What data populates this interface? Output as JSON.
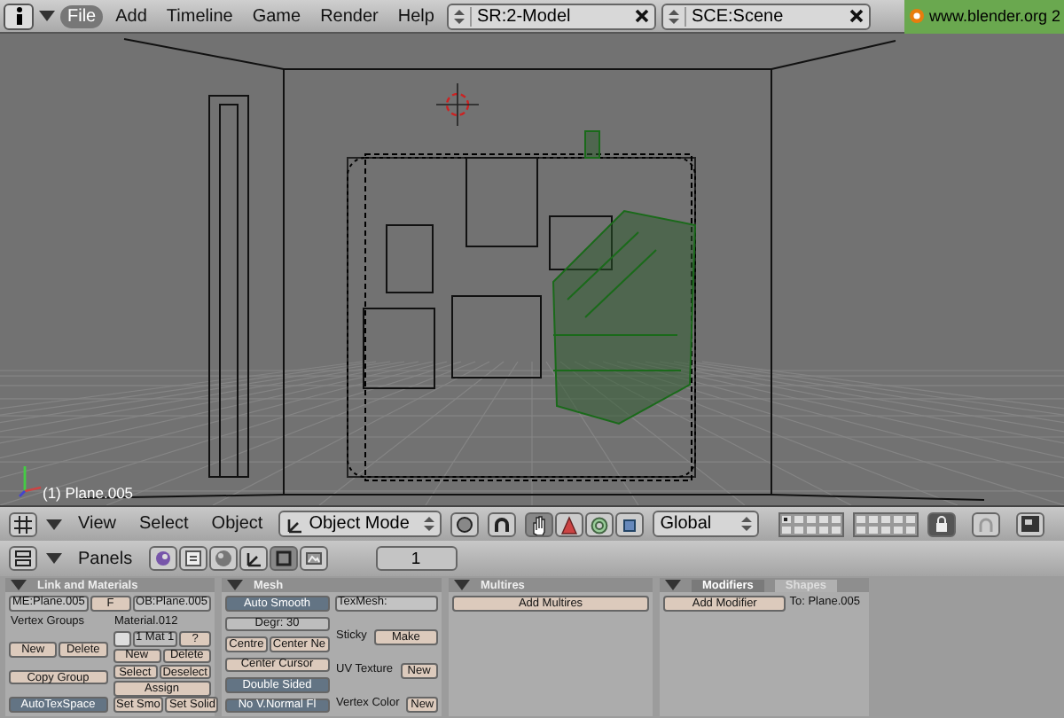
{
  "menu_bar": {
    "menus": [
      {
        "label": "File",
        "selected": true
      },
      {
        "label": "Add",
        "selected": false
      },
      {
        "label": "Timeline",
        "selected": false
      },
      {
        "label": "Game",
        "selected": false
      },
      {
        "label": "Render",
        "selected": false
      },
      {
        "label": "Help",
        "selected": false
      }
    ],
    "screen_field": "SR:2-Model",
    "scene_field": "SCE:Scene",
    "info": "www.blender.org 2"
  },
  "viewport": {
    "object_label": "(1) Plane.005"
  },
  "view_header": {
    "menus": [
      "View",
      "Select",
      "Object"
    ],
    "mode": "Object Mode",
    "manipulator_tools": [
      {
        "kind": "hand",
        "selected": true
      },
      {
        "kind": "translate",
        "selected": false
      },
      {
        "kind": "rotate",
        "selected": false
      },
      {
        "kind": "scale",
        "selected": false
      }
    ],
    "orientation": "Global",
    "layers": [
      {
        "active": true
      },
      {
        "active": false
      },
      {
        "active": false
      },
      {
        "active": false
      },
      {
        "active": false
      },
      {
        "active": false
      },
      {
        "active": false
      },
      {
        "active": false
      },
      {
        "active": false
      },
      {
        "active": false
      },
      {
        "active": false
      },
      {
        "active": false
      },
      {
        "active": false
      },
      {
        "active": false
      },
      {
        "active": false
      },
      {
        "active": false
      },
      {
        "active": false
      },
      {
        "active": false
      },
      {
        "active": false
      },
      {
        "active": false
      }
    ],
    "lock": {
      "selected": true
    }
  },
  "buttons_header": {
    "menu": "Panels",
    "contexts": [
      {
        "kind": "logic",
        "selected": false
      },
      {
        "kind": "script",
        "selected": false
      },
      {
        "kind": "shading",
        "selected": false
      },
      {
        "kind": "object",
        "selected": false
      },
      {
        "kind": "editing",
        "selected": true
      },
      {
        "kind": "scene",
        "selected": false
      }
    ],
    "frame": "1"
  },
  "panels": [
    {
      "title": "Link and Materials",
      "top": [
        [
          {
            "kind": "field",
            "text": "ME:Plane.005"
          },
          {
            "kind": "button",
            "text": "F"
          },
          {
            "kind": "field",
            "text": "OB:Plane.005"
          }
        ]
      ],
      "columns": [
        [
          [
            {
              "kind": "label",
              "text": "Vertex Groups"
            }
          ],
          [
            {
              "kind": "button",
              "text": "New"
            },
            {
              "kind": "button",
              "text": "Delete"
            }
          ],
          [
            {
              "kind": "button",
              "text": "Copy Group"
            }
          ],
          [
            {
              "kind": "toggle",
              "text": "AutoTexSpace",
              "on": true
            }
          ]
        ],
        [
          [
            {
              "kind": "label",
              "text": "Material.012"
            }
          ],
          [
            {
              "kind": "swatch"
            },
            {
              "kind": "number",
              "text": "1 Mat 1"
            },
            {
              "kind": "button",
              "text": "?"
            }
          ],
          [
            {
              "kind": "button",
              "text": "New"
            },
            {
              "kind": "button",
              "text": "Delete"
            }
          ],
          [
            {
              "kind": "button",
              "text": "Select"
            },
            {
              "kind": "button",
              "text": "Deselect"
            }
          ],
          [
            {
              "kind": "button",
              "text": "Assign"
            }
          ],
          [
            {
              "kind": "button",
              "text": "Set Smo"
            },
            {
              "kind": "button",
              "text": "Set Solid"
            }
          ]
        ]
      ]
    },
    {
      "title": "Mesh",
      "columns": [
        [
          [
            {
              "kind": "toggle",
              "text": "Auto Smooth",
              "on": true
            }
          ],
          [
            {
              "kind": "number",
              "text": "Degr: 30"
            }
          ],
          [
            {
              "kind": "button",
              "text": "Centre"
            },
            {
              "kind": "button",
              "text": "Center Ne"
            }
          ],
          [
            {
              "kind": "button",
              "text": "Center Cursor"
            }
          ],
          [
            {
              "kind": "toggle",
              "text": "Double Sided",
              "on": true
            }
          ],
          [
            {
              "kind": "toggle",
              "text": "No V.Normal Fl",
              "on": true
            }
          ]
        ],
        [
          [
            {
              "kind": "field",
              "text": "TexMesh:"
            }
          ],
          [
            {
              "kind": "label",
              "text": "Sticky"
            },
            {
              "kind": "button",
              "text": "Make"
            }
          ],
          [
            {
              "kind": "label",
              "text": "UV Texture"
            },
            {
              "kind": "button",
              "text": "New"
            }
          ],
          [
            {
              "kind": "label",
              "text": "Vertex Color"
            },
            {
              "kind": "button",
              "text": "New"
            }
          ]
        ]
      ]
    },
    {
      "title": "Multires",
      "columns": [
        [
          [
            {
              "kind": "button",
              "text": "Add Multires"
            }
          ]
        ]
      ]
    },
    {
      "tabs": [
        {
          "label": "Modifiers",
          "selected": true
        },
        {
          "label": "Shapes",
          "selected": false
        }
      ],
      "top": [
        [
          {
            "kind": "button",
            "text": "Add Modifier"
          },
          {
            "kind": "label",
            "text": "To: Plane.005"
          }
        ]
      ]
    }
  ]
}
